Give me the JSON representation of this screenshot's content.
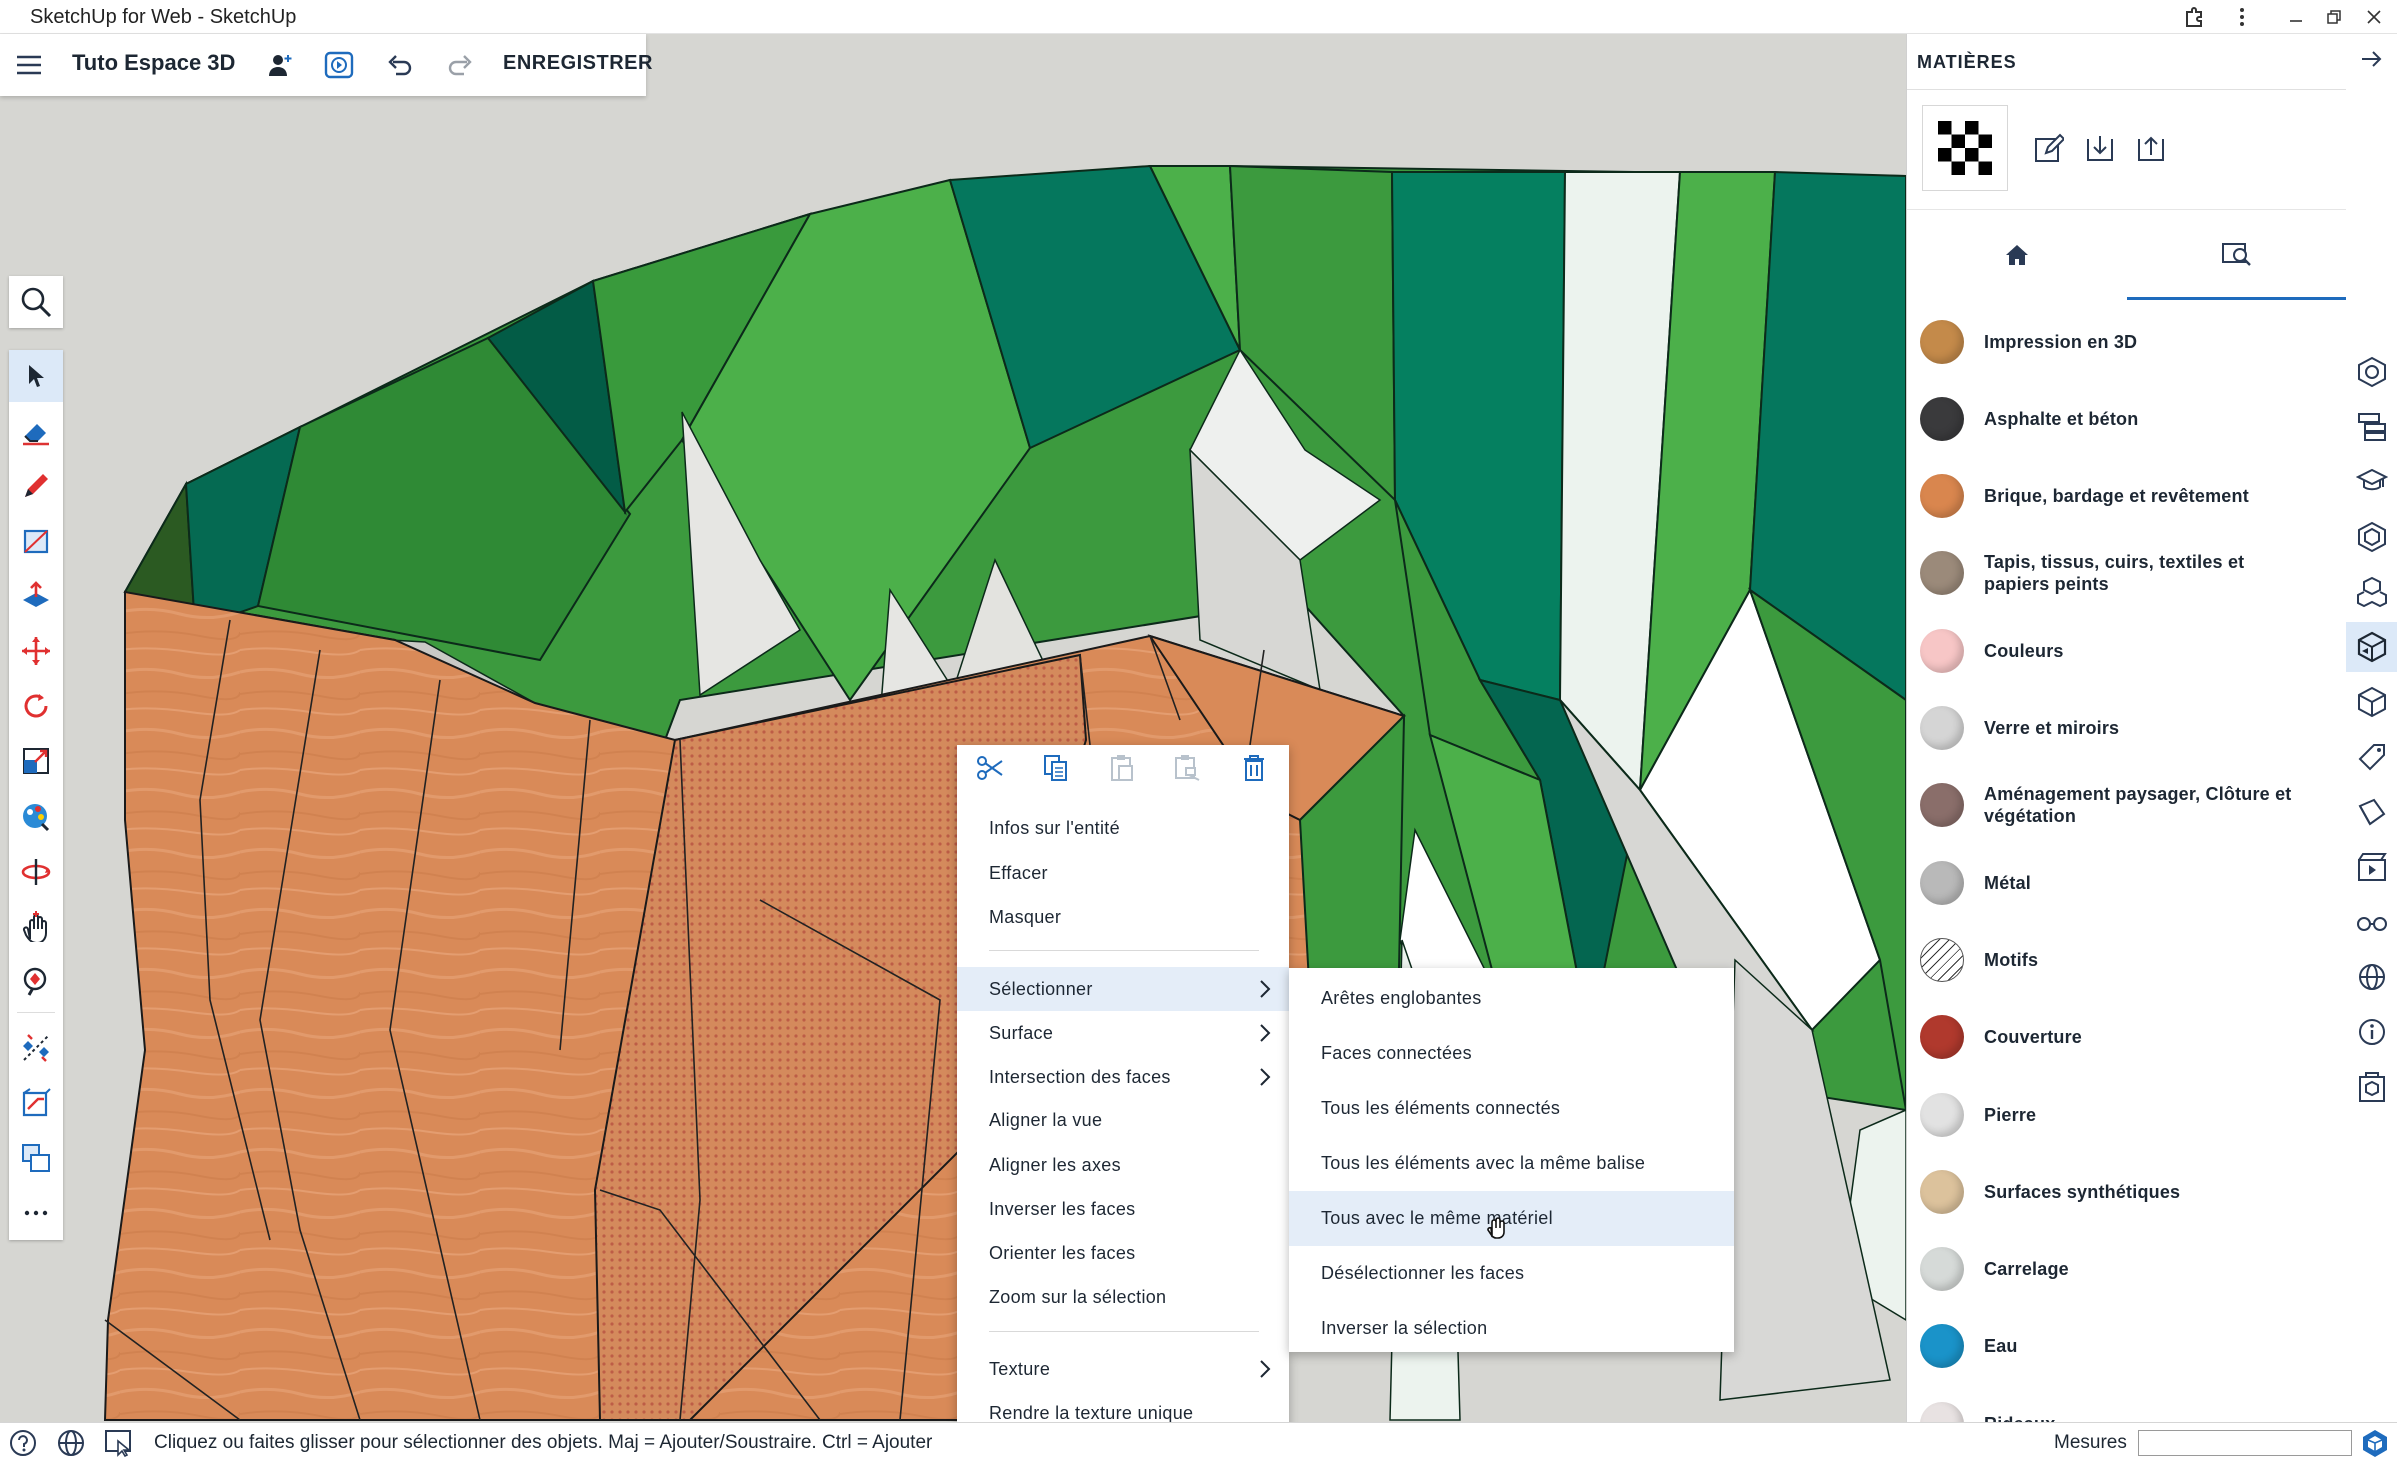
{
  "window": {
    "title": "SketchUp for Web - SketchUp"
  },
  "project": {
    "name": "Tuto Espace 3D",
    "save_label": "ENREGISTRER"
  },
  "context_menu": {
    "toolbar_icons": [
      "cut-icon",
      "copy-icon",
      "paste-icon",
      "paste-in-place-icon",
      "delete-icon"
    ],
    "items": [
      {
        "label": "Infos sur l'entité",
        "submenu": false
      },
      {
        "label": "Effacer",
        "submenu": false
      },
      {
        "label": "Masquer",
        "submenu": false
      },
      {
        "label": "Sélectionner",
        "submenu": true,
        "highlighted": true
      },
      {
        "label": "Surface",
        "submenu": true
      },
      {
        "label": "Intersection des faces",
        "submenu": true
      },
      {
        "label": "Aligner la vue",
        "submenu": false
      },
      {
        "label": "Aligner les axes",
        "submenu": false
      },
      {
        "label": "Inverser les faces",
        "submenu": false
      },
      {
        "label": "Orienter les faces",
        "submenu": false
      },
      {
        "label": "Zoom sur la sélection",
        "submenu": false
      },
      {
        "label": "Texture",
        "submenu": true
      },
      {
        "label": "Rendre la texture unique",
        "submenu": false
      }
    ]
  },
  "submenu": {
    "items": [
      {
        "label": "Arêtes englobantes"
      },
      {
        "label": "Faces connectées"
      },
      {
        "label": "Tous les éléments connectés"
      },
      {
        "label": "Tous les éléments avec la même balise"
      },
      {
        "label": "Tous avec le même matériel",
        "highlighted": true
      },
      {
        "label": "Désélectionner les faces"
      },
      {
        "label": "Inverser la sélection"
      }
    ]
  },
  "materials_panel": {
    "title": "MATIÈRES",
    "tabs": [
      "home-icon",
      "browse-materials-icon"
    ],
    "active_tab": 1,
    "categories": [
      {
        "label": "Impression en 3D",
        "color": "#c48a4a"
      },
      {
        "label": "Asphalte et béton",
        "color": "#3a3a3c"
      },
      {
        "label": "Brique, bardage et revêtement",
        "color": "#d9864e"
      },
      {
        "label": "Tapis, tissus, cuirs, textiles et papiers peints",
        "color": "#9b8a7a"
      },
      {
        "label": "Couleurs",
        "color": "#f7c6c6"
      },
      {
        "label": "Verre et miroirs",
        "color": "#d5d5d5"
      },
      {
        "label": "Aménagement paysager, Clôture et végétation",
        "color": "#8a6e6a"
      },
      {
        "label": "Métal",
        "color": "#b9b9b9"
      },
      {
        "label": "Motifs",
        "color": "#ffffff"
      },
      {
        "label": "Couverture",
        "color": "#b0392d"
      },
      {
        "label": "Pierre",
        "color": "#e2e2e2"
      },
      {
        "label": "Surfaces synthétiques",
        "color": "#dcc29c"
      },
      {
        "label": "Carrelage",
        "color": "#d6dad8"
      },
      {
        "label": "Eau",
        "color": "#1a93c9"
      },
      {
        "label": "Rideaux",
        "color": "#e8e2e2"
      }
    ]
  },
  "status_bar": {
    "message": "Cliquez ou faites glisser pour sélectionner des objets. Maj = Ajouter/Soustraire. Ctrl = Ajouter",
    "measures_label": "Mesures",
    "measures_value": ""
  },
  "colors": {
    "accent": "#1e6bbd",
    "dark_green": "#00735a",
    "green": "#4cb04a",
    "wood": "#d98a5a"
  }
}
